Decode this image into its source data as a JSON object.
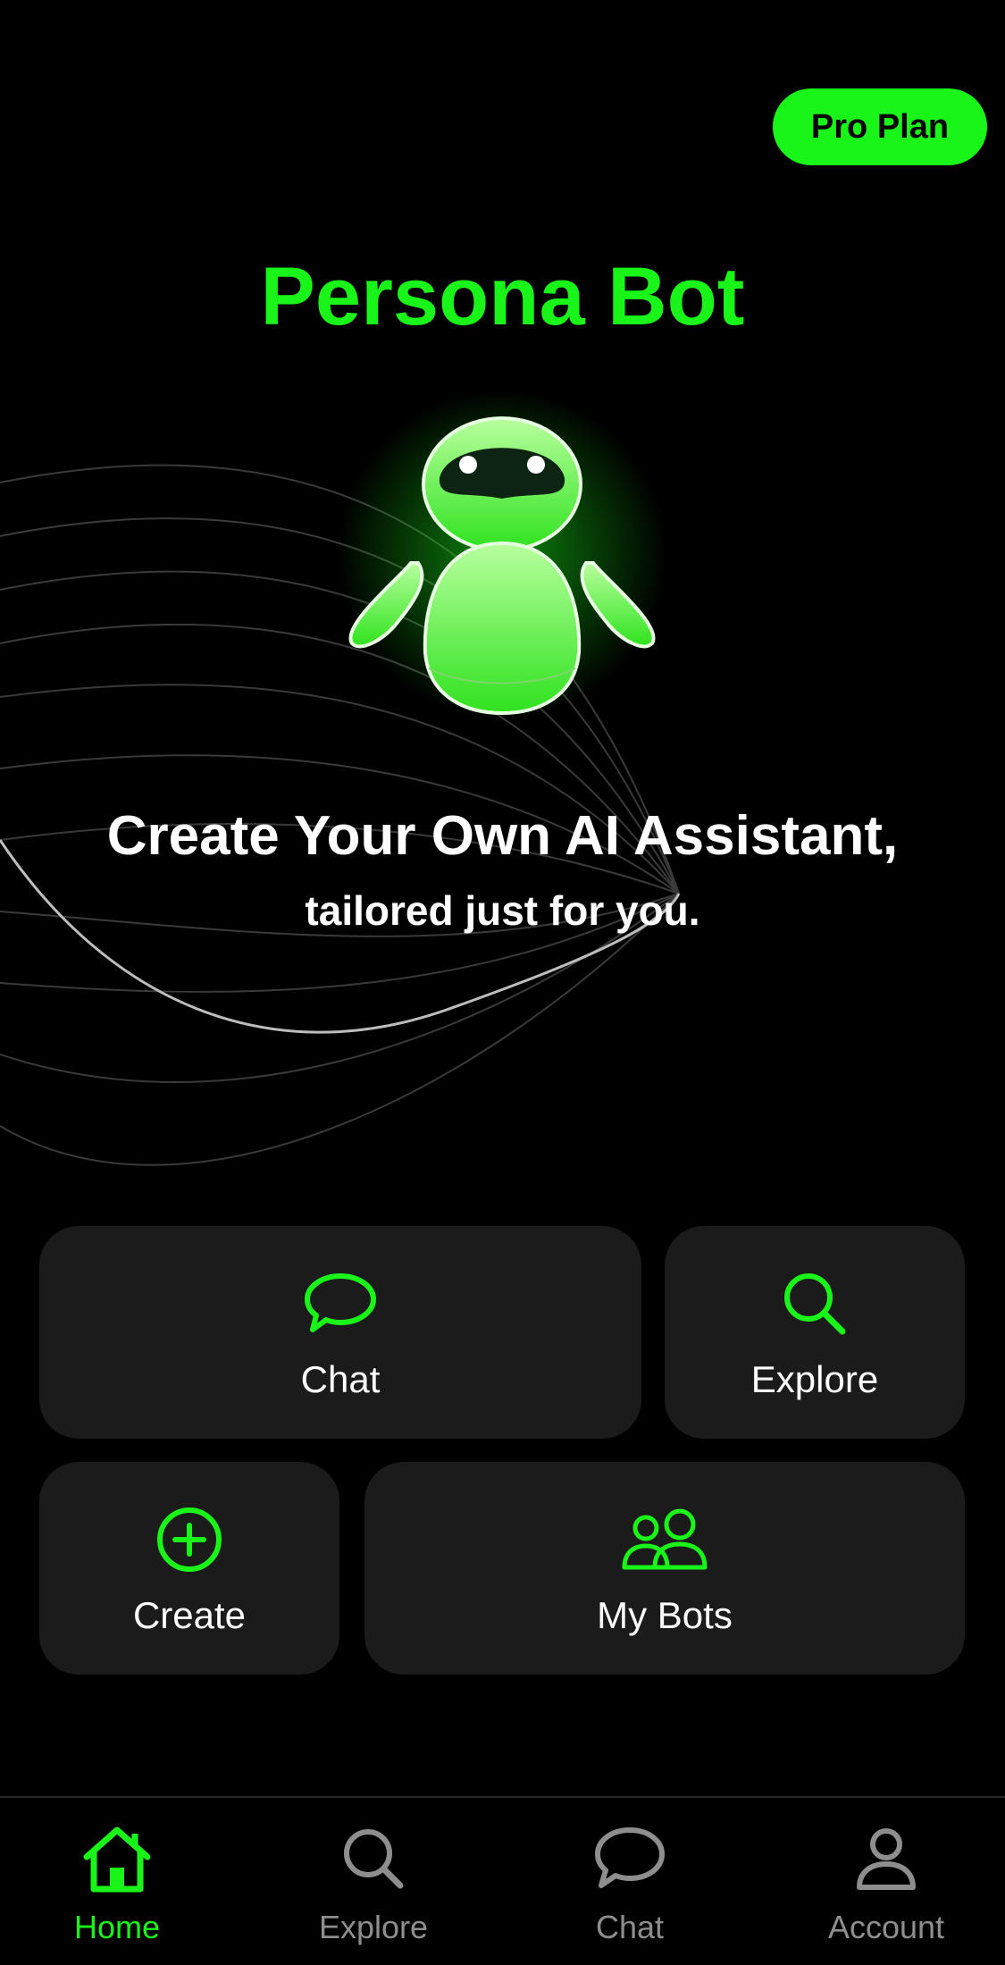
{
  "header": {
    "pro_label": "Pro Plan"
  },
  "hero": {
    "title": "Persona Bot",
    "tagline": "Create Your Own AI Assistant,",
    "subtagline": "tailored just for you."
  },
  "actions": {
    "chat": {
      "label": "Chat",
      "icon": "chat-bubble-icon"
    },
    "explore": {
      "label": "Explore",
      "icon": "search-icon"
    },
    "create": {
      "label": "Create",
      "icon": "plus-circle-icon"
    },
    "my_bots": {
      "label": "My Bots",
      "icon": "users-icon"
    }
  },
  "tabbar": {
    "home": {
      "label": "Home",
      "icon": "home-icon",
      "active": true
    },
    "explore": {
      "label": "Explore",
      "icon": "search-icon"
    },
    "chat": {
      "label": "Chat",
      "icon": "chat-bubble-icon"
    },
    "account": {
      "label": "Account",
      "icon": "person-icon"
    }
  },
  "colors": {
    "accent": "#19f518",
    "card": "#1b1b1b",
    "background": "#000000",
    "inactive": "#8e8e8e"
  }
}
